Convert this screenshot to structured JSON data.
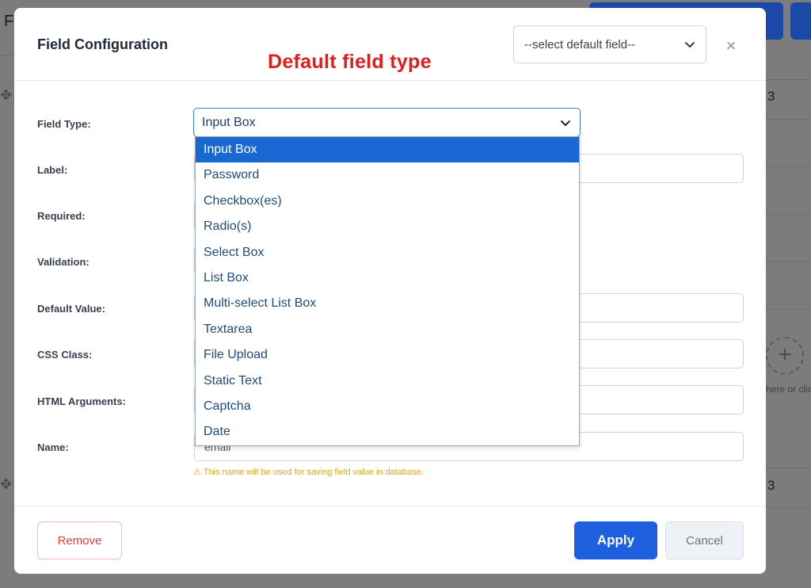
{
  "background": {
    "letter_top": "F",
    "letter_right_top": "3",
    "letter_right_bottom": "3",
    "add_hint": "here or clic"
  },
  "modal": {
    "title": "Field Configuration",
    "annotation": "Default field type",
    "default_select": "--select default field--",
    "close_symbol": "×"
  },
  "form": {
    "field_type_label": "Field Type:",
    "field_type_value": "Input Box",
    "label_label": "Label:",
    "required_label": "Required:",
    "validation_label": "Validation:",
    "default_value_label": "Default Value:",
    "css_class_label": "CSS Class:",
    "html_args_label": "HTML Arguments:",
    "name_label": "Name:",
    "name_value": "email",
    "name_hint": "⚠ This name will be used for saving field value in database."
  },
  "dropdown": {
    "options": [
      "Input Box",
      "Password",
      "Checkbox(es)",
      "Radio(s)",
      "Select Box",
      "List Box",
      "Multi-select List Box",
      "Textarea",
      "File Upload",
      "Static Text",
      "Captcha",
      "Date"
    ],
    "selected_index": 0
  },
  "footer": {
    "remove_label": "Remove",
    "apply_label": "Apply",
    "cancel_label": "Cancel"
  },
  "colors": {
    "primary": "#1e5fe0",
    "annotation": "#e11d1d",
    "selected_option": "#1967d2",
    "hint": "#e1a514"
  }
}
